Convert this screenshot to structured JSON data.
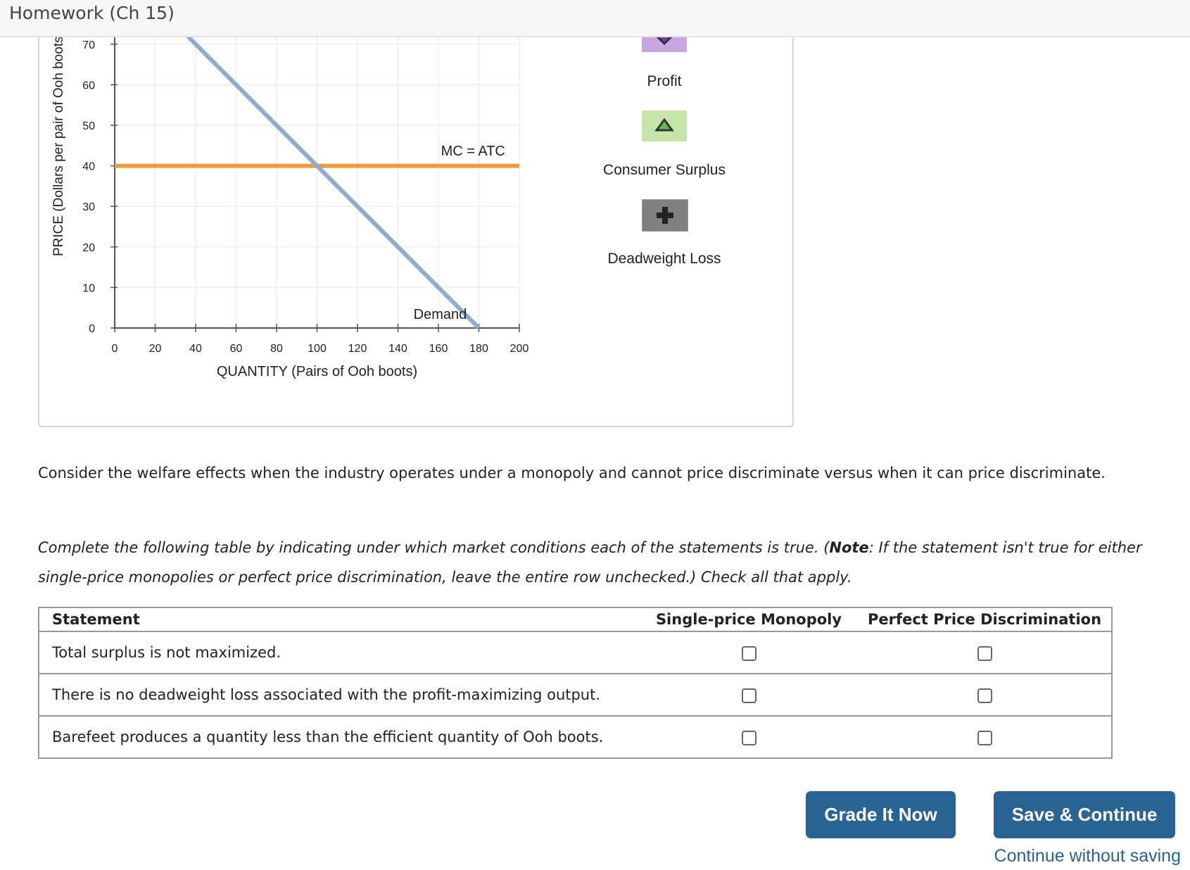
{
  "header": {
    "title": "Homework (Ch 15)"
  },
  "legend": {
    "items": [
      {
        "label": "Profit",
        "color": "#c8a6e2",
        "icon": "down-triangle-icon"
      },
      {
        "label": "Consumer Surplus",
        "color": "#c6e6aa",
        "icon": "triangle-icon"
      },
      {
        "label": "Deadweight Loss",
        "color": "#808080",
        "icon": "plus-icon"
      }
    ]
  },
  "chart_data": {
    "type": "line",
    "xlabel": "QUANTITY (Pairs of Ooh boots)",
    "ylabel": "PRICE (Dollars per pair of Ooh boots)",
    "xlim": [
      0,
      200
    ],
    "ylim": [
      0,
      80
    ],
    "x_ticks": [
      "0",
      "20",
      "40",
      "60",
      "80",
      "100",
      "120",
      "140",
      "160",
      "180",
      "200"
    ],
    "y_ticks": [
      "0",
      "10",
      "20",
      "30",
      "40",
      "50",
      "60",
      "70"
    ],
    "grid": true,
    "series": [
      {
        "name": "Demand",
        "color": "#8aaed3",
        "points": [
          [
            0,
            90
          ],
          [
            180,
            0
          ]
        ]
      },
      {
        "name": "MC = ATC",
        "color": "#f09c3a",
        "points": [
          [
            0,
            40
          ],
          [
            200,
            40
          ]
        ]
      }
    ]
  },
  "question": {
    "prompt": "Consider the welfare effects when the industry operates under a monopoly and cannot price discriminate versus when it can price discriminate.",
    "instructions_pre": "Complete the following table by indicating under which market conditions each of the statements is true. (",
    "instructions_note": "Note",
    "instructions_post": ": If the statement isn't true for either single-price monopolies or perfect price discrimination, leave the entire row unchecked.) Check all that apply."
  },
  "table": {
    "headers": [
      "Statement",
      "Single-price Monopoly",
      "Perfect Price Discrimination"
    ],
    "rows": [
      {
        "statement": "Total surplus is not maximized.",
        "single": false,
        "perfect": false
      },
      {
        "statement": "There is no deadweight loss associated with the profit-maximizing output.",
        "single": false,
        "perfect": false
      },
      {
        "statement": "Barefeet produces a quantity less than the efficient quantity of Ooh boots.",
        "single": false,
        "perfect": false
      }
    ]
  },
  "actions": {
    "grade": "Grade It Now",
    "save": "Save & Continue",
    "continue": "Continue without saving"
  }
}
